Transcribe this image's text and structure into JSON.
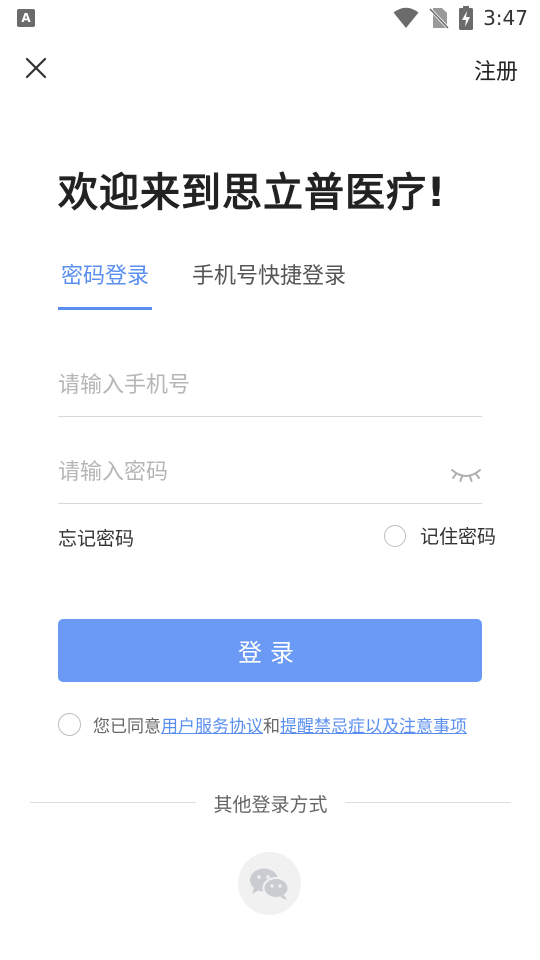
{
  "status_bar": {
    "left_icon_letter": "A",
    "time": "3:47",
    "icons": [
      "wifi-icon",
      "no-sim-icon",
      "battery-charging-icon"
    ]
  },
  "header": {
    "close_icon": "close-icon",
    "register_label": "注册"
  },
  "welcome": {
    "title": "欢迎来到思立普医疗!"
  },
  "tabs": [
    {
      "label": "密码登录",
      "active": true
    },
    {
      "label": "手机号快捷登录",
      "active": false
    }
  ],
  "form": {
    "phone_placeholder": "请输入手机号",
    "phone_value": "",
    "password_placeholder": "请输入密码",
    "password_value": "",
    "eye_icon": "eye-closed-icon",
    "forgot_label": "忘记密码",
    "remember_label": "记住密码",
    "remember_checked": false
  },
  "login_button": {
    "label": "登录"
  },
  "agreement": {
    "checked": false,
    "prefix": "您已同意",
    "link1": "用户服务协议",
    "conjunction": "和",
    "link2": "提醒禁忌症以及注意事项"
  },
  "other_login": {
    "title": "其他登录方式",
    "methods": [
      "wechat-icon"
    ]
  },
  "colors": {
    "accent": "#5a8ff0",
    "button": "#6a9af5",
    "placeholder": "#b6b6b6"
  }
}
